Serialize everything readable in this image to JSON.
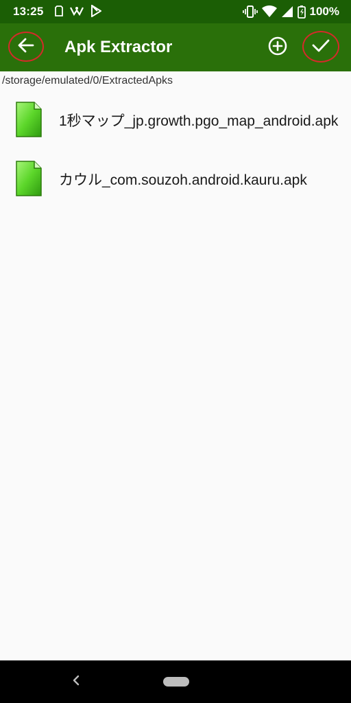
{
  "status_bar": {
    "time": "13:25",
    "battery_percent": "100%",
    "left_icons": [
      "sim-card-icon",
      "notification-icon",
      "play-store-icon"
    ],
    "right_icons": [
      "vibrate-icon",
      "wifi-icon",
      "signal-icon",
      "battery-icon"
    ]
  },
  "app_bar": {
    "title": "Apk Extractor",
    "back_icon": "arrow-back-icon",
    "add_icon": "add-circle-icon",
    "confirm_icon": "check-icon"
  },
  "path": "/storage/emulated/0/ExtractedApks",
  "files": [
    {
      "name": "1秒マップ_jp.growth.pgo_map_android.apk",
      "icon": "file-icon"
    },
    {
      "name": "カウル_com.souzoh.android.kauru.apk",
      "icon": "file-icon"
    }
  ],
  "colors": {
    "status_bar": "#1b5e05",
    "app_bar": "#2a700a",
    "highlight_circle": "#d52a2a",
    "file_icon_green": "#5cd62a"
  }
}
